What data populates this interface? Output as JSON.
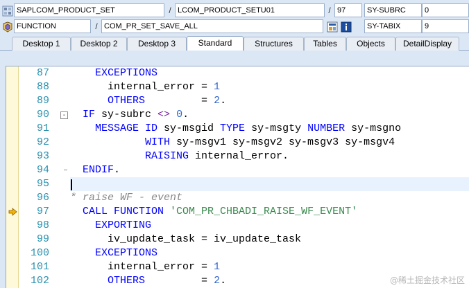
{
  "header": {
    "program": "SAPLCOM_PRODUCT_SET",
    "include": "LCOM_PRODUCT_SETU01",
    "line_no": "97",
    "var1_name": "SY-SUBRC",
    "var1_value": "0",
    "event_type": "FUNCTION",
    "event_name": "COM_PR_SET_SAVE_ALL",
    "var2_name": "SY-TABIX",
    "var2_value": "9",
    "separator": "/"
  },
  "tabs": [
    {
      "label": "Desktop 1"
    },
    {
      "label": "Desktop 2"
    },
    {
      "label": "Desktop 3"
    },
    {
      "label": "Standard",
      "active": true
    },
    {
      "label": "Structures"
    },
    {
      "label": "Tables"
    },
    {
      "label": "Objects"
    },
    {
      "label": "DetailDisplay"
    }
  ],
  "code_lines": [
    {
      "num": "87",
      "tokens": [
        [
          "kw",
          "    EXCEPTIONS"
        ]
      ]
    },
    {
      "num": "88",
      "tokens": [
        [
          "op",
          "      internal_error "
        ],
        [
          "op",
          "= "
        ],
        [
          "num",
          "1"
        ]
      ]
    },
    {
      "num": "89",
      "tokens": [
        [
          "kw",
          "      OTHERS"
        ],
        [
          "op",
          "         = "
        ],
        [
          "num",
          "2"
        ],
        [
          "op",
          "."
        ]
      ]
    },
    {
      "num": "90",
      "fold": "-",
      "tokens": [
        [
          "kw",
          "  IF "
        ],
        [
          "op",
          "sy-subrc "
        ],
        [
          "sym",
          "<>"
        ],
        [
          "op",
          " "
        ],
        [
          "num",
          "0"
        ],
        [
          "op",
          "."
        ]
      ]
    },
    {
      "num": "91",
      "tokens": [
        [
          "kw",
          "    MESSAGE ID "
        ],
        [
          "op",
          "sy-msgid "
        ],
        [
          "kw",
          "TYPE "
        ],
        [
          "op",
          "sy-msgty "
        ],
        [
          "kw",
          "NUMBER "
        ],
        [
          "op",
          "sy-msgno"
        ]
      ]
    },
    {
      "num": "92",
      "tokens": [
        [
          "kw",
          "            WITH "
        ],
        [
          "op",
          "sy-msgv1 sy-msgv2 sy-msgv3 sy-msgv4"
        ]
      ]
    },
    {
      "num": "93",
      "tokens": [
        [
          "kw",
          "            RAISING "
        ],
        [
          "op",
          "internal_error."
        ]
      ]
    },
    {
      "num": "94",
      "foldend": true,
      "tokens": [
        [
          "kw",
          "  ENDIF"
        ],
        [
          "op",
          "."
        ]
      ]
    },
    {
      "num": "95",
      "tokens": []
    },
    {
      "num": "96",
      "tokens": [
        [
          "cmt",
          "* raise WF - event"
        ]
      ]
    },
    {
      "num": "97",
      "breakpoint": true,
      "tokens": [
        [
          "kw",
          "  CALL FUNCTION "
        ],
        [
          "str",
          "'COM_PR_CHBADI_RAISE_WF_EVENT'"
        ]
      ]
    },
    {
      "num": "98",
      "tokens": [
        [
          "kw",
          "    EXPORTING"
        ]
      ]
    },
    {
      "num": "99",
      "tokens": [
        [
          "op",
          "      iv_update_task = iv_update_task"
        ]
      ]
    },
    {
      "num": "100",
      "tokens": [
        [
          "kw",
          "    EXCEPTIONS"
        ]
      ]
    },
    {
      "num": "101",
      "tokens": [
        [
          "op",
          "      internal_error "
        ],
        [
          "op",
          "= "
        ],
        [
          "num",
          "1"
        ]
      ]
    },
    {
      "num": "102",
      "tokens": [
        [
          "kw",
          "      OTHERS"
        ],
        [
          "op",
          "         = "
        ],
        [
          "num",
          "2"
        ],
        [
          "op",
          "."
        ]
      ]
    }
  ],
  "icons": {
    "event": "function-block-icon",
    "program": "program-grid-icon",
    "detail": "detail-view-icon",
    "info": "info-icon",
    "breakpoint": "current-statement-arrow-icon"
  },
  "colors": {
    "keyword": "#0000ff",
    "number": "#3366cc",
    "string": "#3a8a4e",
    "comment": "#888888",
    "line_number": "#2b91af",
    "gutter": "#fdf9d9",
    "frame": "#dce7f5"
  },
  "watermark": "@稀土掘金技术社区"
}
